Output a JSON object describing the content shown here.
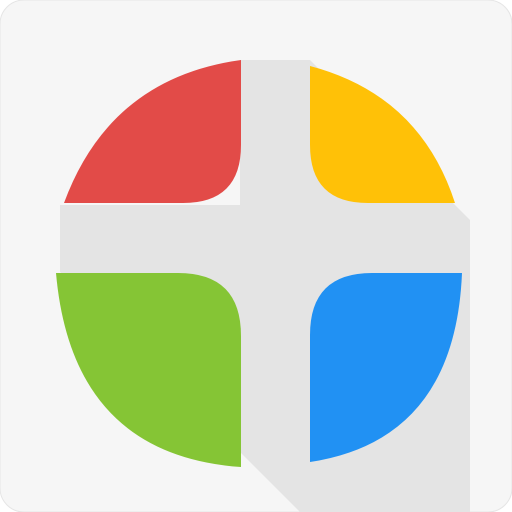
{
  "icon": {
    "name": "four-color-cross-app-icon",
    "colors": {
      "tile_background": "#f6f6f6",
      "tile_shadow_edge": "#e5e5e5",
      "long_shadow": "#e4e4e4",
      "top_left_petal": "#e24b48",
      "top_right_petal": "#ffc107",
      "bottom_left_petal": "#85c535",
      "bottom_right_petal": "#2191f3"
    }
  }
}
